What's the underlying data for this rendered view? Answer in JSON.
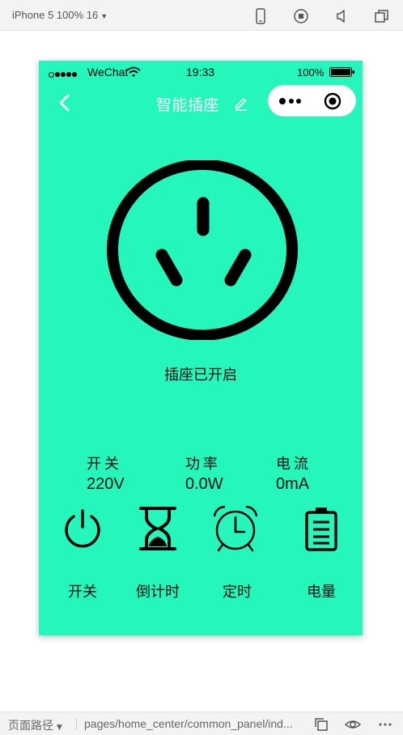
{
  "devtools": {
    "device_select": "iPhone 5 100% 16",
    "path_label": "页面路径",
    "path_value": "pages/home_center/common_panel/ind..."
  },
  "status_bar": {
    "carrier": "WeChat",
    "time": "19:33",
    "battery_percent": "100%",
    "battery_level": 1.0
  },
  "navbar": {
    "title": "智能插座"
  },
  "socket": {
    "status_text": "插座已开启"
  },
  "stats": [
    {
      "label": "开关",
      "value": "220V"
    },
    {
      "label": "功率",
      "value": "0.0W"
    },
    {
      "label": "电流",
      "value": "0mA"
    }
  ],
  "actions": [
    {
      "label": "开关",
      "icon": "power-icon"
    },
    {
      "label": "倒计时",
      "icon": "hourglass-icon"
    },
    {
      "label": "定时",
      "icon": "alarm-clock-icon"
    },
    {
      "label": "电量",
      "icon": "battery-icon"
    }
  ],
  "colors": {
    "background": "#24f6bc",
    "title_text": "#ffffff",
    "foreground": "#000000"
  }
}
